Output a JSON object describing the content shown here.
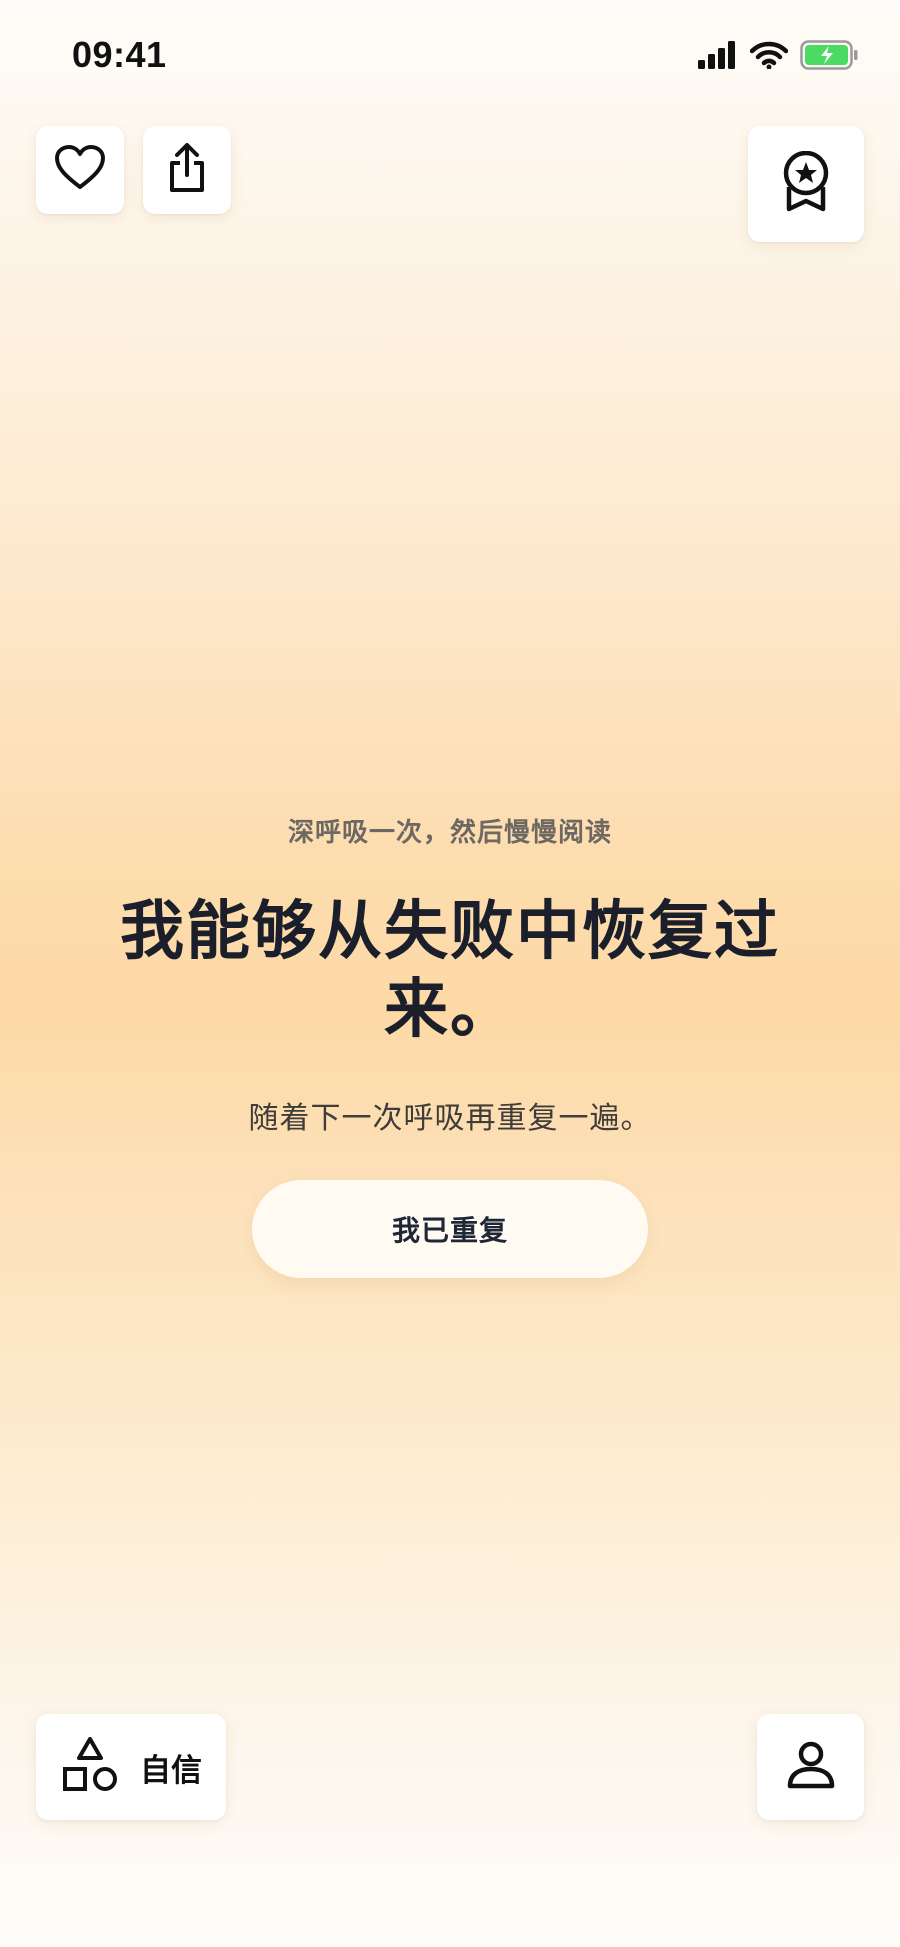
{
  "status_bar": {
    "time": "09:41",
    "icons": [
      "cellular-signal-icon",
      "wifi-icon",
      "battery-charging-icon"
    ],
    "battery_color": "#4cd964"
  },
  "top_actions": {
    "like_icon": "heart-icon",
    "share_icon": "share-icon",
    "award_icon": "award-badge-icon"
  },
  "main": {
    "hint": "深呼吸一次，然后慢慢阅读",
    "affirmation": "我能够从失败中恢复过来。",
    "instruction": "随着下一次呼吸再重复一遍。",
    "repeat_button_label": "我已重复"
  },
  "bottom": {
    "category_icon": "shapes-icon",
    "category_label": "自信",
    "profile_icon": "profile-icon"
  },
  "colors": {
    "background_top": "#fefcf9",
    "background_mid": "#fdd9a6",
    "text_primary": "#1b1f2b",
    "text_hint": "#6d6862"
  }
}
